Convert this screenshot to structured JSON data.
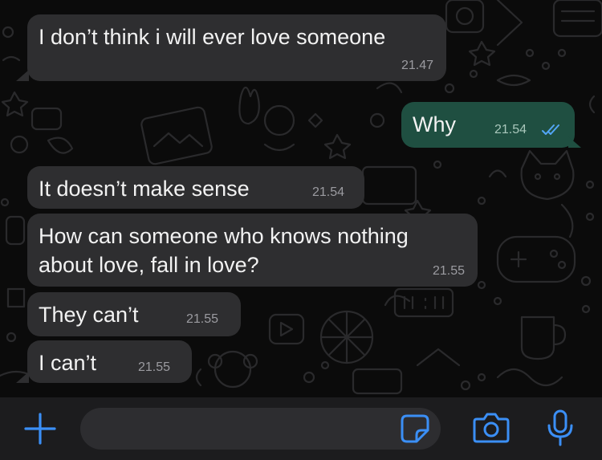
{
  "messages": [
    {
      "direction": "incoming",
      "text": "I don’t think i will ever love someone",
      "time": "21.47"
    },
    {
      "direction": "outgoing",
      "text": "Why",
      "time": "21.54",
      "status": "read"
    },
    {
      "direction": "incoming",
      "text": "It doesn’t make sense",
      "time": "21.54"
    },
    {
      "direction": "incoming",
      "lines": [
        "How can someone who knows nothing",
        "about love, fall in love?"
      ],
      "time": "21.55"
    },
    {
      "direction": "incoming",
      "text": "They can’t",
      "time": "21.55"
    },
    {
      "direction": "incoming",
      "text": "I can’t",
      "time": "21.55"
    }
  ],
  "composer": {
    "placeholder": ""
  },
  "icons": {
    "attach": "plus-icon",
    "sticker": "sticker-icon",
    "camera": "camera-icon",
    "mic": "microphone-icon",
    "read_receipt": "double-check-icon"
  },
  "colors": {
    "incoming_bubble": "#2e2e30",
    "outgoing_bubble": "#1f4f41",
    "accent": "#3b8ff6",
    "read_ticks": "#53a6f7",
    "wallpaper": "#0b0b0b",
    "composer_bar": "#1c1c1e"
  }
}
